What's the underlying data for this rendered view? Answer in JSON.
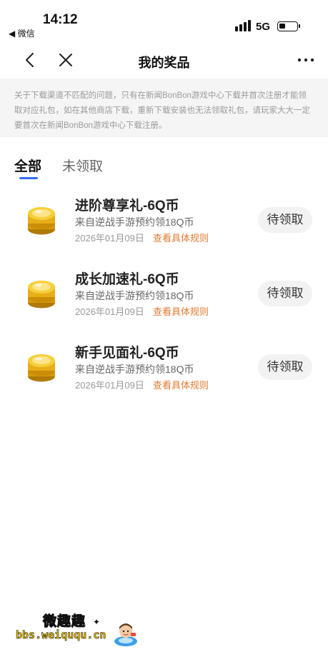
{
  "status_bar": {
    "time": "14:12",
    "back_app": "◀ 微信",
    "network": "5G"
  },
  "nav": {
    "title": "我的奖品",
    "icons": [
      "chevron-left-icon",
      "close-icon",
      "more-icon"
    ]
  },
  "notice": {
    "text": "关于下载渠道不匹配的问题，只有在新闻BonBon游戏中心下载并首次注册才能领取对应礼包，如在其他商店下载，重新下载安装也无法领取礼包，请玩家大大一定要首次在新闻BonBon游戏中心下载注册。"
  },
  "tabs": [
    {
      "label": "全部",
      "active": true
    },
    {
      "label": "未领取",
      "active": false
    }
  ],
  "colors": {
    "accent": "#2f6bff",
    "rule_link": "#e07a32",
    "notice_bg": "#f5f5f5",
    "button_bg": "#f2f2f2"
  },
  "prizes": [
    {
      "title": "进阶尊享礼-6Q币",
      "source": "来自逆战手游预约领18Q币",
      "date": "2026年01月09日",
      "rule_link": "查看具体规则",
      "button": "待领取",
      "icon": "coin-stack-icon"
    },
    {
      "title": "成长加速礼-6Q币",
      "source": "来自逆战手游预约领18Q币",
      "date": "2026年01月09日",
      "rule_link": "查看具体规则",
      "button": "待领取",
      "icon": "coin-stack-icon"
    },
    {
      "title": "新手见面礼-6Q币",
      "source": "来自逆战手游预约领18Q币",
      "date": "2026年01月09日",
      "rule_link": "查看具体规则",
      "button": "待领取",
      "icon": "coin-stack-icon"
    }
  ],
  "watermark": {
    "title": "微趣趣",
    "url": "bbs.weiququ.cn"
  }
}
